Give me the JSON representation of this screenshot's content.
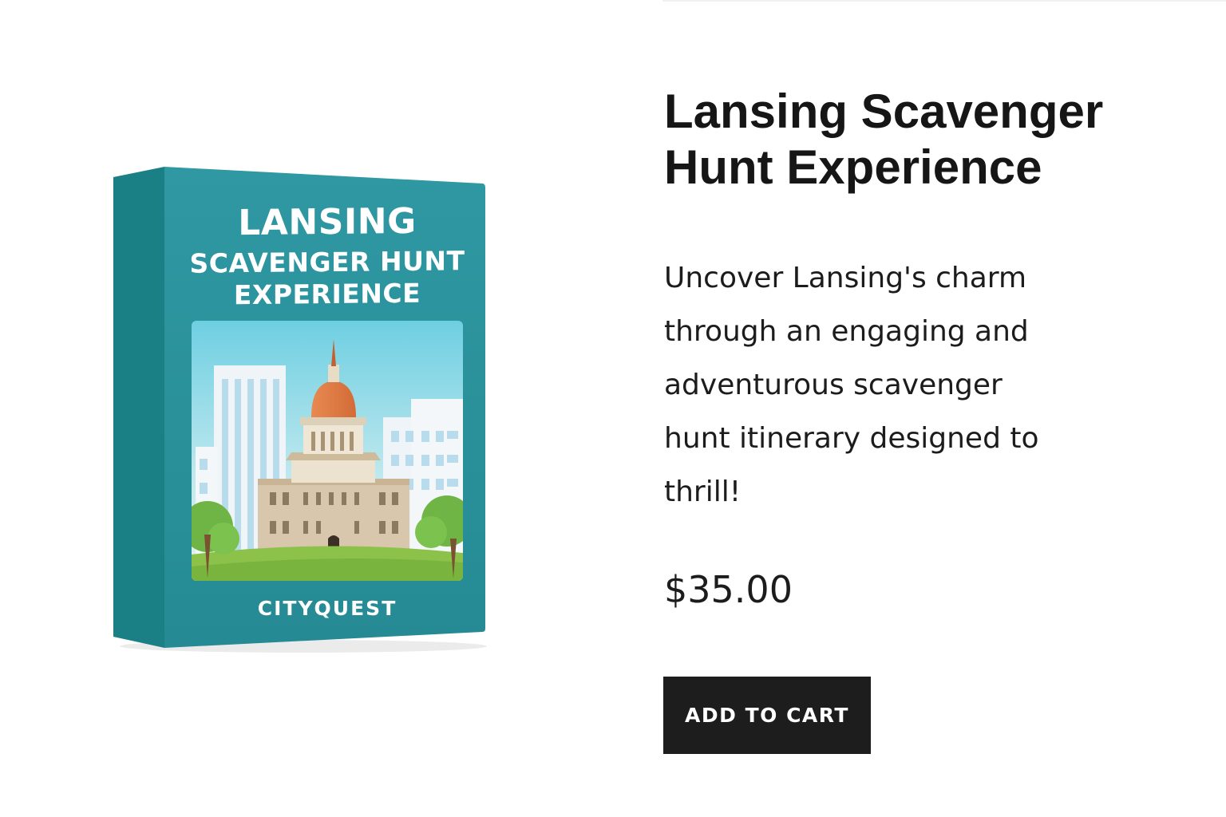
{
  "product": {
    "title": "Lansing Scavenger Hunt Experience",
    "description": "Uncover Lansing's charm through an engaging and adventurous scavenger hunt itinerary designed to thrill!",
    "price": "$35.00",
    "add_to_cart_label": "ADD TO CART",
    "image": {
      "title_line1": "LANSING",
      "title_line2": "SCAVENGER HUNT",
      "title_line3": "EXPERIENCE",
      "brand": "CITYQUEST",
      "box_color": "#2a9199",
      "side_color": "#1b7f86"
    }
  },
  "colors": {
    "button_background": "#1d1d1d",
    "text": "#161616"
  }
}
